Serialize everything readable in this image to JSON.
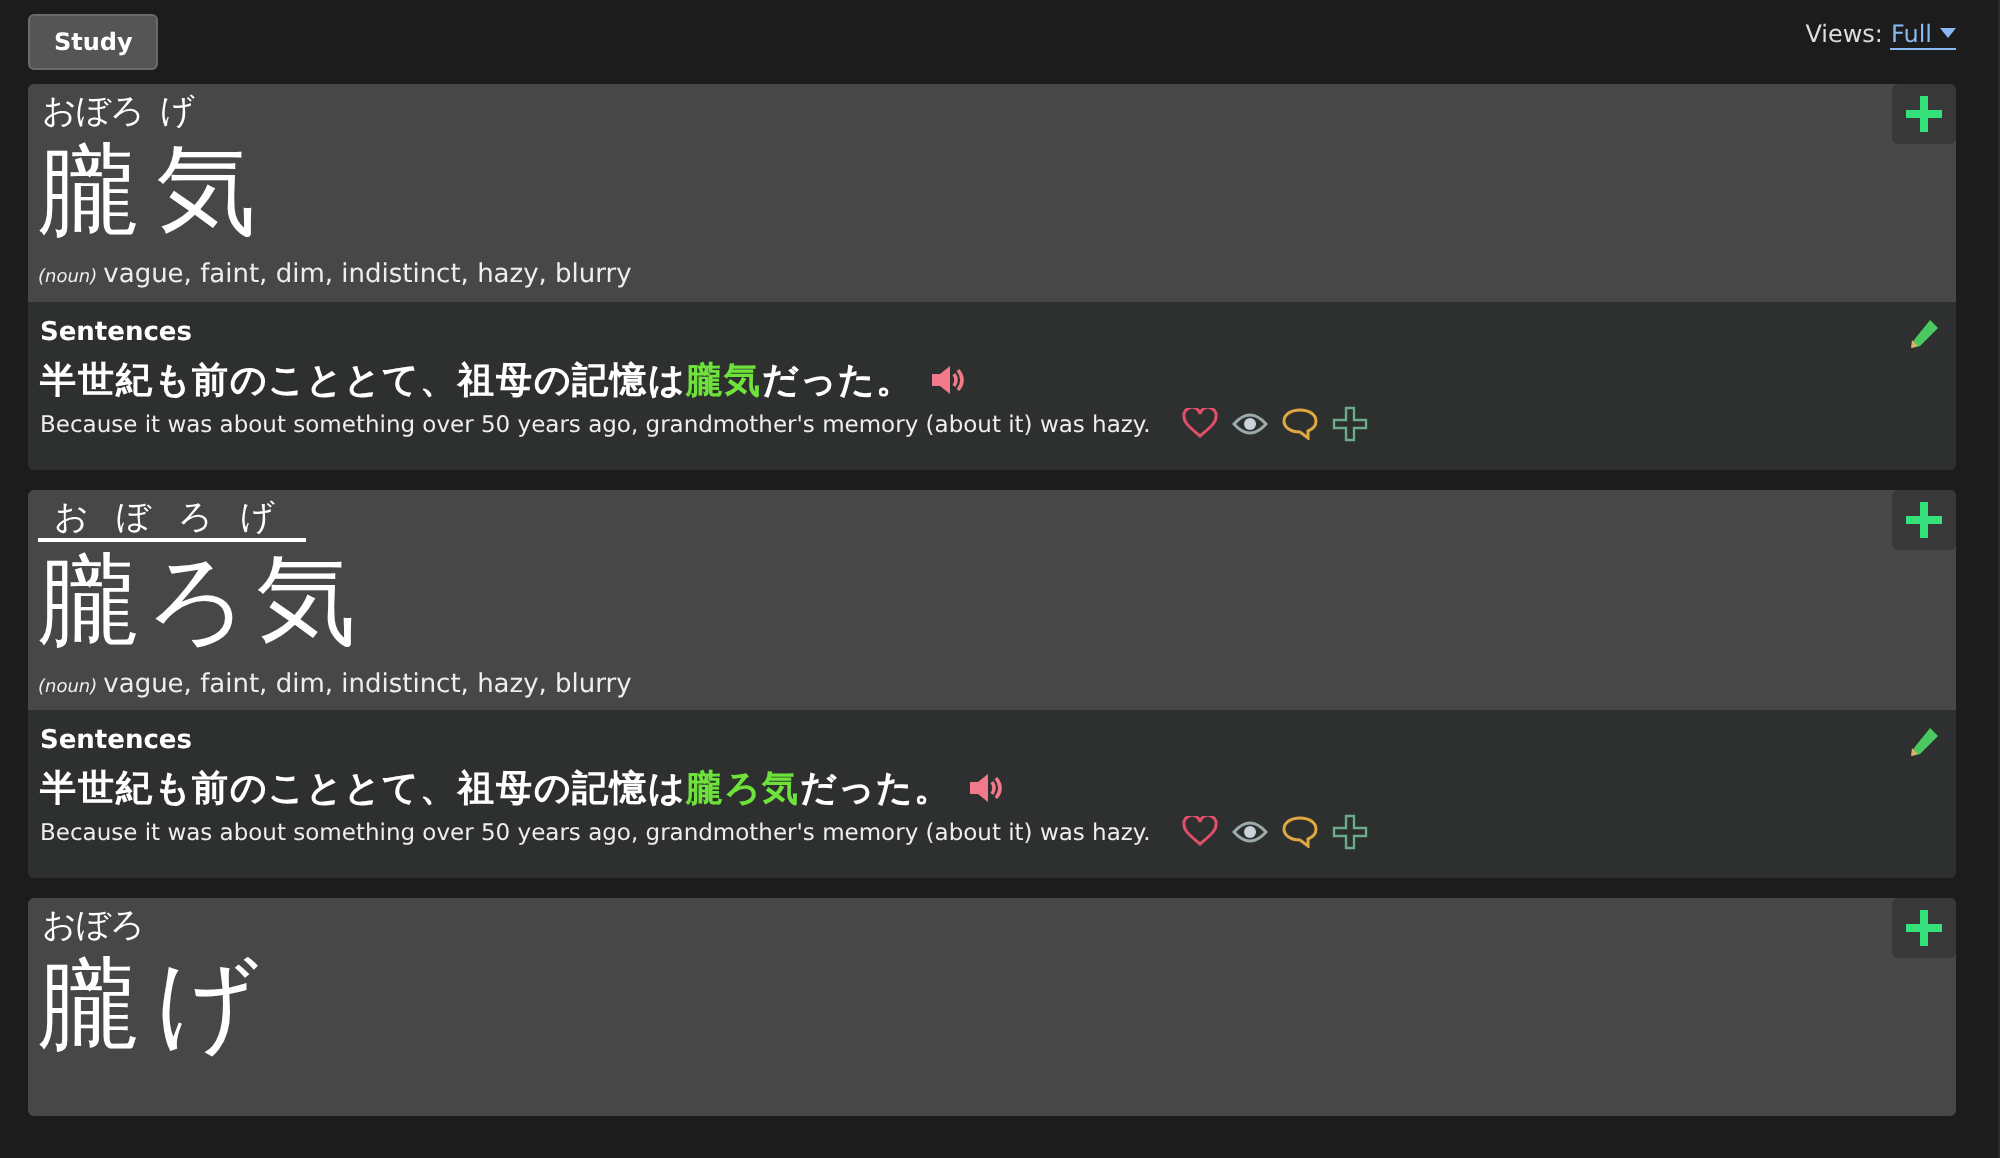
{
  "toolbar": {
    "study_button": "Study",
    "views_label": "Views:",
    "views_value": "Full"
  },
  "entries": [
    {
      "reading_rule": false,
      "segments": [
        {
          "text": "朧",
          "reading": "おぼろ"
        },
        {
          "text": "気",
          "reading": "げ"
        }
      ],
      "pos": "(noun)",
      "meaning": "vague, faint, dim, indistinct, hazy, blurry",
      "sentences_title": "Sentences",
      "sentence": {
        "before": "半世紀も前のこととて、祖母の記憶は",
        "highlight": "朧気",
        "after": "だった。"
      },
      "translation": "Because it was about something over 50 years ago, grandmother's memory (about it) was hazy."
    },
    {
      "reading_rule": true,
      "segments": [
        {
          "text": "朧ろ気",
          "reading": "おぼろげ"
        }
      ],
      "pos": "(noun)",
      "meaning": "vague, faint, dim, indistinct, hazy, blurry",
      "sentences_title": "Sentences",
      "sentence": {
        "before": "半世紀も前のこととて、祖母の記憶は",
        "highlight": "朧ろ気",
        "after": "だった。"
      },
      "translation": "Because it was about something over 50 years ago, grandmother's memory (about it) was hazy."
    },
    {
      "reading_rule": false,
      "segments": [
        {
          "text": "朧",
          "reading": "おぼろ"
        },
        {
          "text": "げ"
        }
      ]
    }
  ]
}
